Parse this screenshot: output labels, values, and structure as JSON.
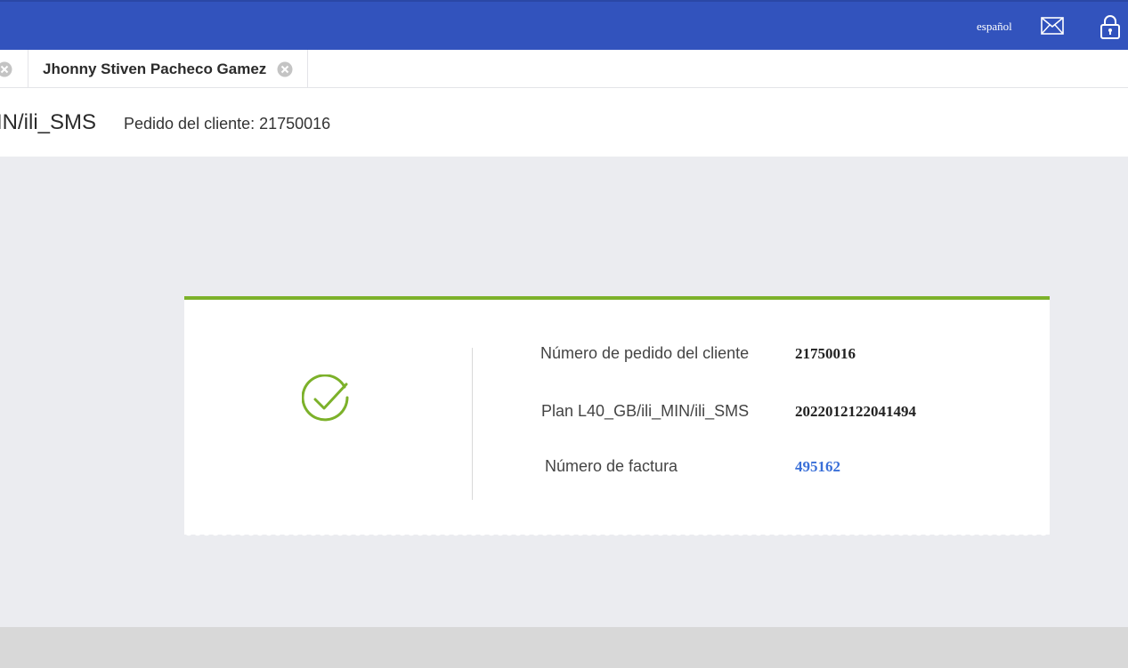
{
  "topbar": {
    "language": "español",
    "mail_icon": "mail-icon",
    "lock_icon": "lock-icon",
    "background": "#3253bd"
  },
  "tabs": {
    "active_label": "Jhonny Stiven Pacheco Gamez"
  },
  "header": {
    "title": "IN/ili_SMS",
    "order_text": "Pedido del cliente: 21750016"
  },
  "card": {
    "accent": "#7cb12a",
    "status_icon": "check-circle-icon",
    "rows": [
      {
        "label": "Número de pedido del cliente",
        "value": "21750016"
      },
      {
        "label": "Plan L40_GB/ili_MIN/ili_SMS",
        "value": "2022012122041494"
      },
      {
        "label": "Número de factura",
        "value": "495162"
      }
    ]
  }
}
